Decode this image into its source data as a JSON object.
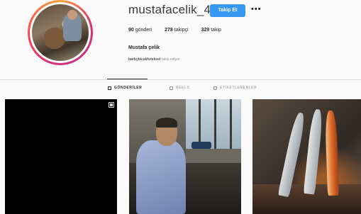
{
  "profile": {
    "username": "mustafacelik_42",
    "follow_label": "Takip Et",
    "more_label": "•••",
    "stats": {
      "posts_count": "90",
      "posts_label": "gönderi",
      "followers_count": "278",
      "followers_label": "takipçi",
      "following_count": "329",
      "following_label": "takip"
    },
    "full_name": "Mustafa çelik",
    "bio_followed_by_name": "barbybicakfotekset",
    "bio_followed_by_text": "takip ediyor"
  },
  "tabs": [
    {
      "label": "GÖNDERİLER",
      "active": true
    },
    {
      "label": "REELS",
      "active": false
    },
    {
      "label": "ETİKETLENENLER",
      "active": false
    }
  ],
  "colors": {
    "follow_button": "#3897f0",
    "background": "#fafafa",
    "divider": "#dbdbdb"
  },
  "icons": {
    "more": "ellipsis-icon",
    "posts_tab": "grid-icon",
    "reels_tab": "reels-icon",
    "tagged_tab": "tag-icon",
    "carousel": "multiple-posts-icon"
  }
}
